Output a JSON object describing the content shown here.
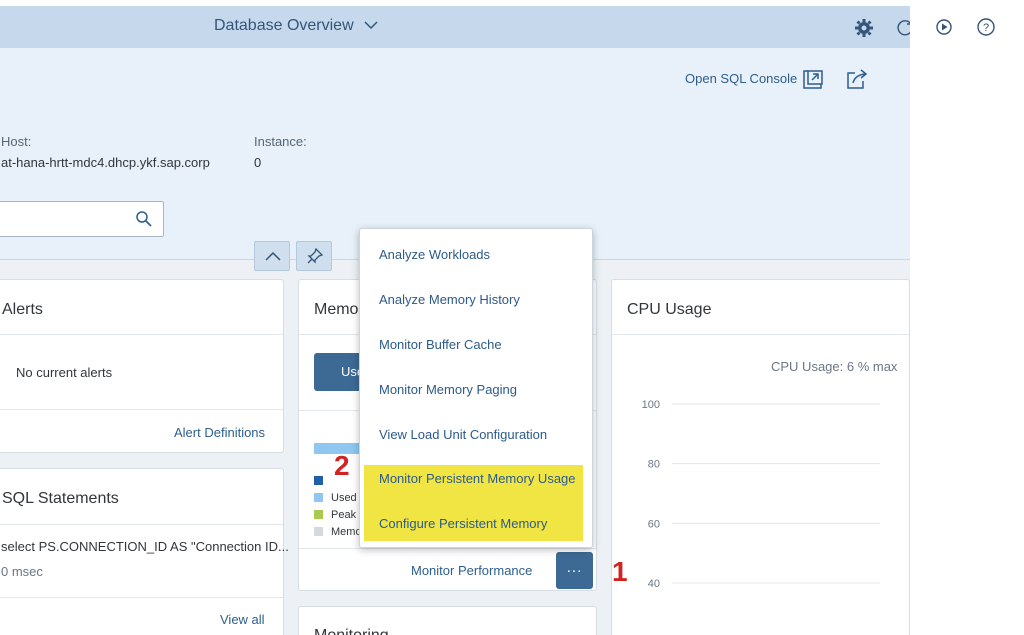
{
  "topbar": {
    "title": "Database Overview",
    "icons": [
      "settings-icon",
      "refresh-icon",
      "play-icon",
      "help-icon"
    ]
  },
  "header": {
    "open_sql_console": "Open SQL Console",
    "host_label": "Host:",
    "host_value": "at-hana-hrtt-mdc4.dhcp.ykf.sap.corp",
    "instance_label": "Instance:",
    "instance_value": "0",
    "search_value": ""
  },
  "alerts_card": {
    "title": "Alerts",
    "message": "No current alerts",
    "footer_link": "Alert Definitions"
  },
  "sql_card": {
    "title": "SQL Statements",
    "statement": "select PS.CONNECTION_ID AS \"Connection ID...",
    "duration": "0 msec",
    "footer_link": "View all"
  },
  "memory_card": {
    "title": "Memo",
    "button_label": "Use",
    "legend": [
      "Used",
      "Peak",
      "Memo"
    ],
    "footer_link": "Monitor Performance",
    "more_label": "..."
  },
  "monitoring_card": {
    "title": "Monitoring"
  },
  "cpu_card": {
    "title": "CPU Usage",
    "caption": "CPU Usage: 6 % max"
  },
  "chart_data": {
    "type": "line",
    "title": "CPU Usage",
    "ylabel": "",
    "yticks": [
      100,
      80,
      60,
      40
    ],
    "ylim": [
      40,
      100
    ],
    "grid": true,
    "series": []
  },
  "menu": {
    "items": [
      "Analyze Workloads",
      "Analyze Memory History",
      "Monitor Buffer Cache",
      "Monitor Memory Paging",
      "View Load Unit Configuration",
      "Monitor Persistent Memory Usage",
      "Configure Persistent Memory"
    ],
    "highlight_color": "#f1e543"
  },
  "markers": {
    "step1": "1",
    "step2": "2"
  },
  "colors": {
    "topbar": "#c6d8ec",
    "accent_button": "#3d6a95",
    "link": "#2d5e8d",
    "marker_red": "#d22323"
  }
}
